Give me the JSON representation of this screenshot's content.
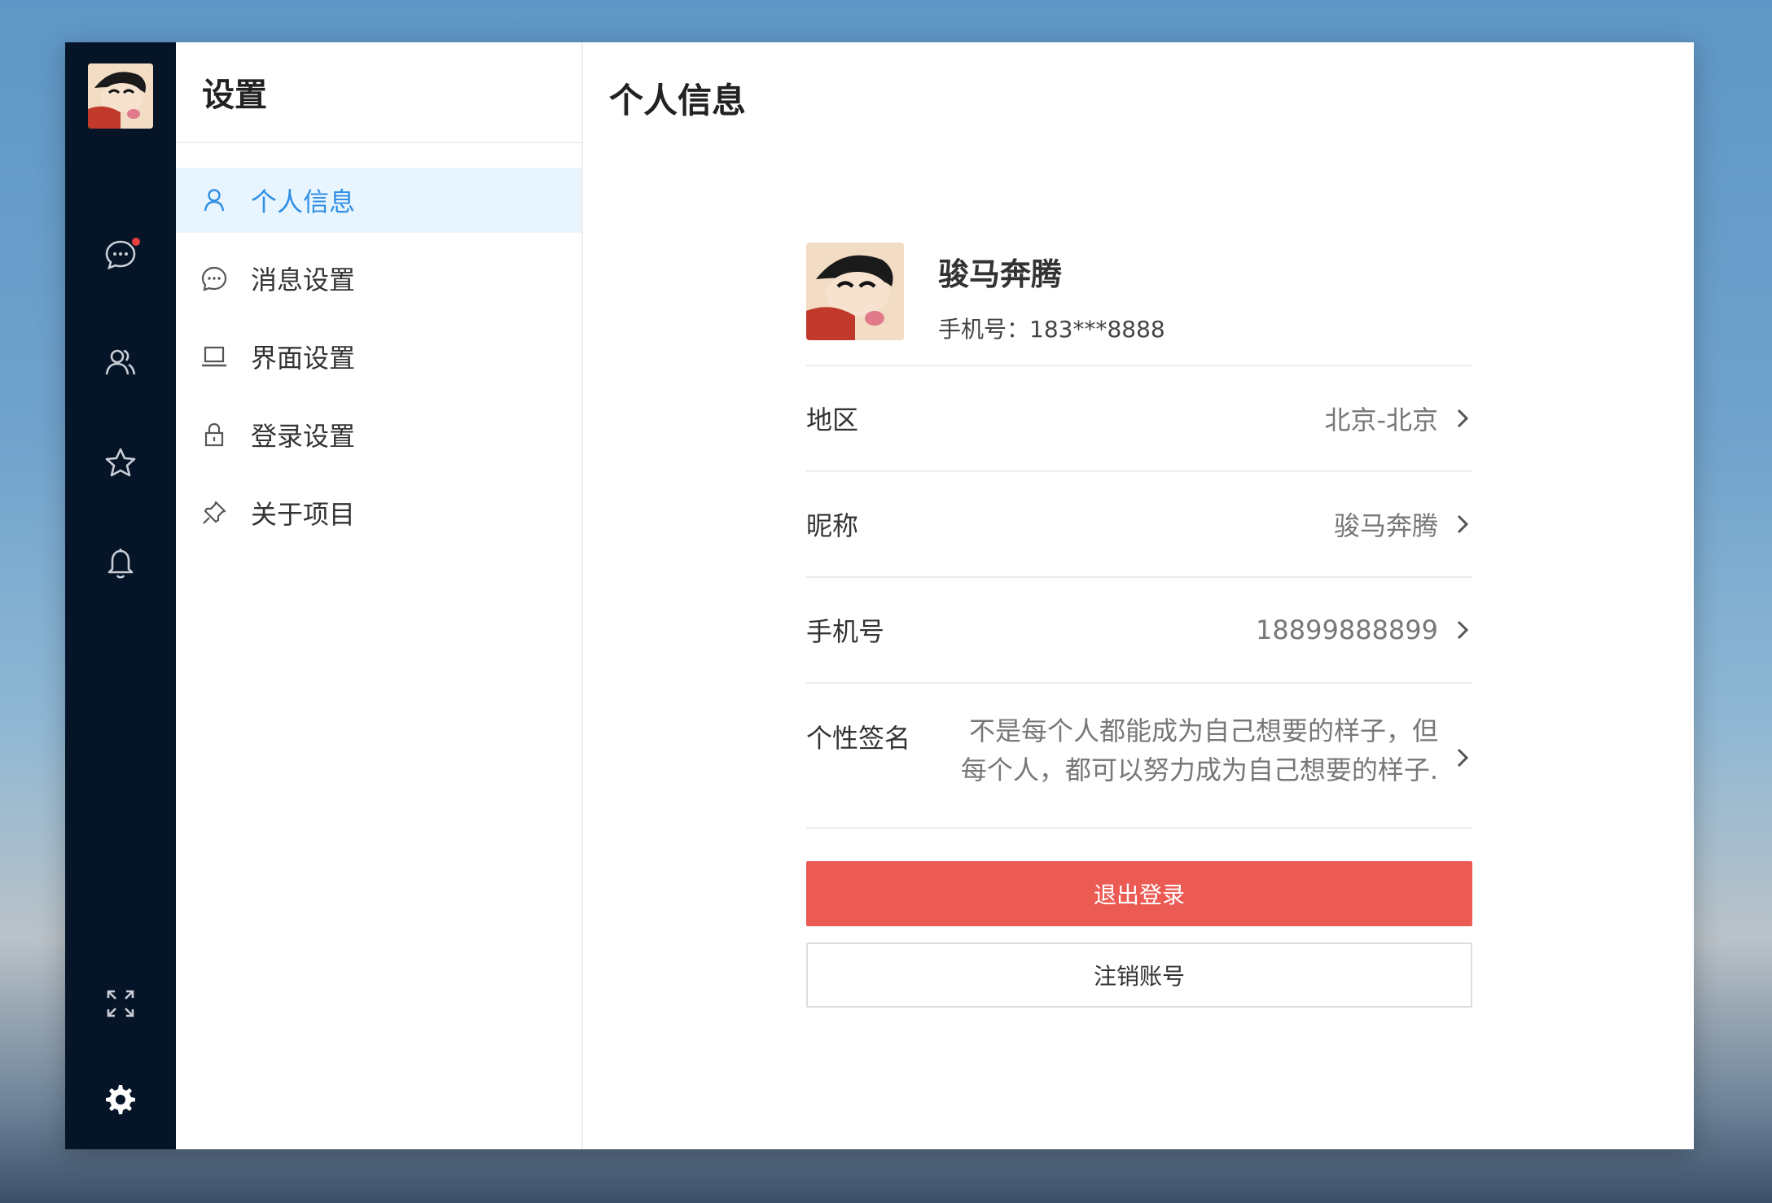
{
  "menu": {
    "title": "设置",
    "items": [
      {
        "label": "个人信息",
        "icon": "user-icon"
      },
      {
        "label": "消息设置",
        "icon": "chat-bubble-icon"
      },
      {
        "label": "界面设置",
        "icon": "laptop-icon"
      },
      {
        "label": "登录设置",
        "icon": "lock-icon"
      },
      {
        "label": "关于项目",
        "icon": "pin-icon"
      }
    ]
  },
  "content": {
    "title": "个人信息",
    "profile": {
      "name": "骏马奔腾",
      "phone": "手机号：183***8888"
    },
    "rows": [
      {
        "label": "地区",
        "value": "北京-北京"
      },
      {
        "label": "昵称",
        "value": "骏马奔腾"
      },
      {
        "label": "手机号",
        "value": "18899888899"
      },
      {
        "label": "个性签名",
        "value": "不是每个人都能成为自己想要的样子，但每个人，都可以努力成为自己想要的样子."
      }
    ],
    "logout_label": "退出登录",
    "cancel_account_label": "注销账号"
  },
  "colors": {
    "rail": "#061428",
    "accent": "#2f8ee5",
    "active_bg": "#e8f5ff",
    "danger": "#ec5a54",
    "notification_dot": "#e8413d"
  }
}
